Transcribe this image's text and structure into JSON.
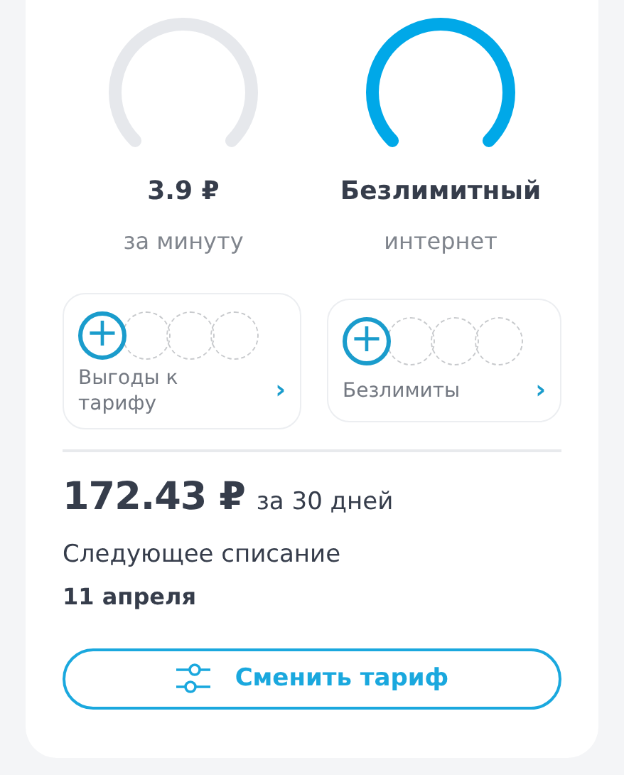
{
  "gauges": [
    {
      "value": "3.9 ₽",
      "label": "за минуту",
      "active": false
    },
    {
      "value": "Безлимитный",
      "label": "интернет",
      "active": true
    }
  ],
  "features": [
    {
      "label": "Выгоды к тарифу",
      "add": "+",
      "arrow": "›"
    },
    {
      "label": "Безлимиты",
      "add": "+",
      "arrow": "›"
    }
  ],
  "price": {
    "amount": "172.43 ₽",
    "period": "за 30 дней"
  },
  "next_charge": {
    "label": "Следующее списание",
    "date": "11 апреля"
  },
  "button": {
    "label": "Сменить тариф"
  }
}
